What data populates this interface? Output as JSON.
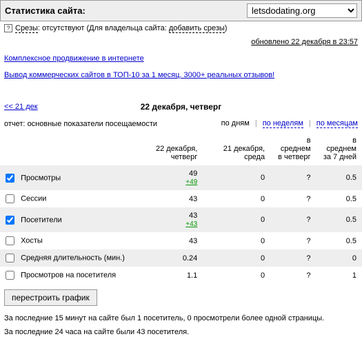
{
  "header": {
    "title": "Статистика сайта:",
    "site": "letsdodating.org"
  },
  "info": {
    "slices_label": "Срезы",
    "slices_value": ": отсутствуют (Для владельца сайта: ",
    "add_link": "добавить срезы",
    "paren_close": ")"
  },
  "updated": "обновлено 22 декабря в 23:57",
  "promo": {
    "link1": "Комплексное продвижение в интернете",
    "link2": "Вывод коммерческих сайтов в ТОП-10 за 1 месяц. 3000+ реальных отзывов!"
  },
  "nav": {
    "prev": "<< 21 дек",
    "title": "22 декабря, четверг"
  },
  "report": {
    "label": "отчет: ",
    "name": "основные показатели посещаемости",
    "tabs": {
      "active": "по дням",
      "week": "по неделям",
      "month": "по месяцам"
    }
  },
  "cols": {
    "c1": "22 декабря, четверг",
    "c2": "21 декабря, среда",
    "c3a": "в среднем",
    "c3b": "в четверг",
    "c4a": "в среднем",
    "c4b": "за 7 дней"
  },
  "rows": [
    {
      "checked": true,
      "name": "Просмотры",
      "v1": "49",
      "d1": "+49",
      "v2": "0",
      "v3": "?",
      "v4": "0.5",
      "hl": true
    },
    {
      "checked": false,
      "name": "Сессии",
      "v1": "43",
      "d1": "",
      "v2": "0",
      "v3": "?",
      "v4": "0.5",
      "hl": false
    },
    {
      "checked": true,
      "name": "Посетители",
      "v1": "43",
      "d1": "+43",
      "v2": "0",
      "v3": "?",
      "v4": "0.5",
      "hl": true
    },
    {
      "checked": false,
      "name": "Хосты",
      "v1": "43",
      "d1": "",
      "v2": "0",
      "v3": "?",
      "v4": "0.5",
      "hl": false
    },
    {
      "checked": false,
      "name": "Средняя длительность (мин.)",
      "v1": "0.24",
      "d1": "",
      "v2": "0",
      "v3": "?",
      "v4": "0",
      "hl": true
    },
    {
      "checked": false,
      "name": "Просмотров на посетителя",
      "v1": "1.1",
      "d1": "",
      "v2": "0",
      "v3": "?",
      "v4": "1",
      "hl": false
    }
  ],
  "rebuild": "перестроить график",
  "footer": {
    "l1": "За последние 15 минут на сайте был 1 посетитель, 0 просмотрели более одной страницы.",
    "l2": "За последние 24 часа на сайте были 43 посетителя."
  }
}
